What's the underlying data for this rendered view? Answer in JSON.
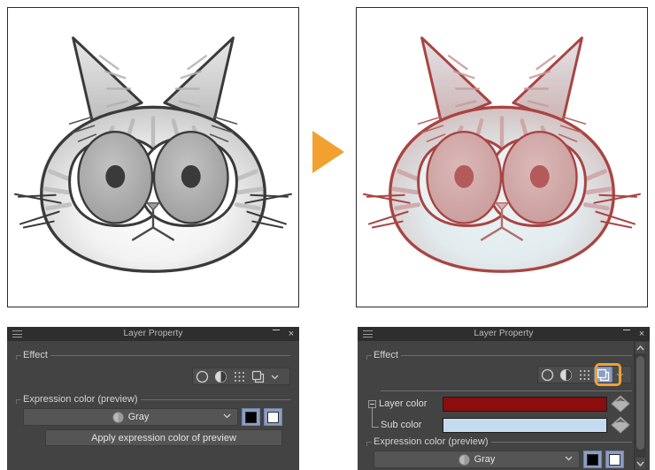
{
  "artwork": {
    "left": {
      "name": "cat-face-grayscale",
      "caption": "Grayscale cat face illustration",
      "line_color": "#333333",
      "fill_light": "#ffffff",
      "fill_mid": "#bdbdbd",
      "fill_dark": "#8a8a8a",
      "pupil_color": "#3a3a3a",
      "iris_color": "#a8a8a8"
    },
    "right": {
      "name": "cat-face-recolored",
      "caption": "Cat face recolored with layer color and sub color",
      "line_color": "#a94442",
      "fill_light": "#dfe9ec",
      "fill_mid": "#cfb5b5",
      "fill_dark": "#c08f8f",
      "pupil_color": "#b55a5a",
      "iris_color": "#d3a8a8"
    },
    "arrow": {
      "name": "process-arrow",
      "color": "#f2a030",
      "direction": "right"
    }
  },
  "panel_left": {
    "title": "Layer Property",
    "menu_icon": "hamburger-icon",
    "minimize_label": "—",
    "close_label": "×",
    "effect": {
      "group_label": "Effect",
      "icons": [
        {
          "name": "effect-none-icon",
          "glyph": "circle-outline",
          "selected": false
        },
        {
          "name": "effect-tone-icon",
          "glyph": "half-filled-circle",
          "selected": false
        },
        {
          "name": "effect-halftone-icon",
          "glyph": "dot-grid",
          "selected": false
        },
        {
          "name": "effect-layer-color-icon",
          "glyph": "stacked-squares",
          "selected": false
        }
      ],
      "caret": "chevron-down-icon"
    },
    "expression": {
      "group_label": "Expression color (preview)",
      "combo_value": "Gray",
      "combo_icon": "gray-circle-icon",
      "combo_caret": "chevron-down-icon",
      "swatch_primary": "#000000",
      "swatch_secondary": "#ffffff",
      "apply_button": "Apply expression color of preview"
    }
  },
  "panel_right": {
    "title": "Layer Property",
    "menu_icon": "hamburger-icon",
    "minimize_label": "—",
    "close_label": "×",
    "effect": {
      "group_label": "Effect",
      "icons": [
        {
          "name": "effect-none-icon",
          "glyph": "circle-outline",
          "selected": false
        },
        {
          "name": "effect-tone-icon",
          "glyph": "half-filled-circle",
          "selected": false
        },
        {
          "name": "effect-halftone-icon",
          "glyph": "dot-grid",
          "selected": false
        },
        {
          "name": "effect-layer-color-icon",
          "glyph": "stacked-squares",
          "selected": true
        }
      ],
      "caret": "chevron-down-icon",
      "selection_highlight_color": "#f2a030"
    },
    "layer_color": {
      "tree_toggle": "collapse-toggle",
      "label": "Layer color",
      "value": "#8b0d0d",
      "picker_icon": "color-picker-diamond-icon"
    },
    "sub_color": {
      "label": "Sub color",
      "value": "#c5dcf0",
      "picker_icon": "color-picker-diamond-icon"
    },
    "expression": {
      "group_label": "Expression color (preview)",
      "combo_value": "Gray",
      "combo_icon": "gray-circle-icon",
      "combo_caret": "chevron-down-icon",
      "swatch_primary": "#000000",
      "swatch_secondary": "#ffffff"
    },
    "scrollbar": {
      "up_arrow": "chevron-up-icon",
      "down_arrow": "chevron-down-icon"
    }
  }
}
